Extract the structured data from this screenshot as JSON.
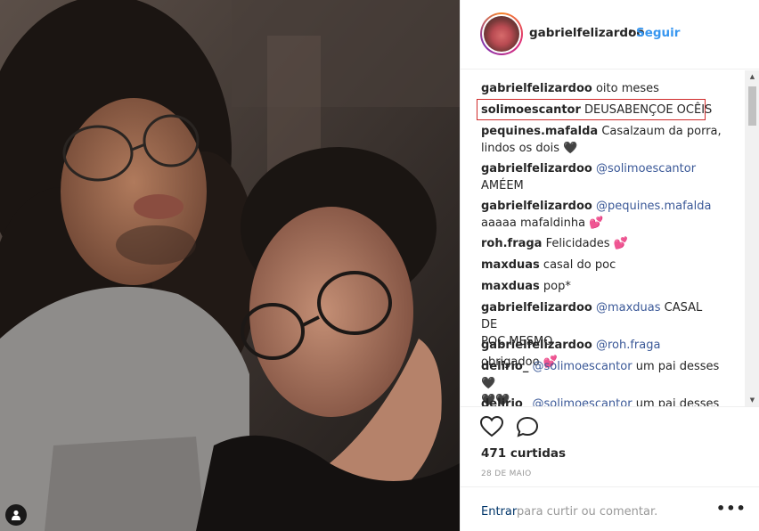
{
  "post": {
    "username": "gabrielfelizardoo",
    "separator": "•",
    "follow_label": "Seguir"
  },
  "comments": [
    {
      "user": "gabrielfelizardoo",
      "mention": "",
      "text": "oito meses",
      "text2": ""
    },
    {
      "user": "solimoescantor",
      "mention": "",
      "text": "DEUSABENÇOE OCÊIS",
      "text2": "",
      "highlighted": true
    },
    {
      "user": "pequines.mafalda",
      "mention": "",
      "text": "Casalzaum da porra,",
      "text2": "lindos os dois 🖤"
    },
    {
      "user": "gabrielfelizardoo",
      "mention": "@solimoescantor",
      "text": "",
      "text2": "AMÉEM"
    },
    {
      "user": "gabrielfelizardoo",
      "mention": "@pequines.mafalda",
      "text": "",
      "text2": "aaaaa mafaldinha 💕"
    },
    {
      "user": "roh.fraga",
      "mention": "",
      "text": "Felicidades 💕",
      "text2": ""
    },
    {
      "user": "maxduas",
      "mention": "",
      "text": "casal do poc",
      "text2": ""
    },
    {
      "user": "maxduas",
      "mention": "",
      "text": "pop*",
      "text2": ""
    },
    {
      "user": "gabrielfelizardoo",
      "mention": "@maxduas",
      "text": "CASAL DE",
      "text2": "POC MESMO"
    },
    {
      "user": "gabrielfelizardoo",
      "mention": "@roh.fraga",
      "text": "obrigadoo 💕",
      "text2": ""
    },
    {
      "user": "delirio_",
      "mention": "@solimoescantor",
      "text": "um pai desses 🖤",
      "text2": "🖤🖤"
    },
    {
      "user": "delirio_",
      "mention": "@solimoescantor",
      "text": "um pai desses 🖤",
      "text2": ""
    }
  ],
  "actions": {
    "heart_icon": "heart-outline-icon",
    "comment_icon": "speech-bubble-icon",
    "likes": "471 curtidas",
    "date": "28 DE MAIO"
  },
  "footer": {
    "login_label": "Entrar",
    "login_rest": "para curtir ou comentar.",
    "more_label": "•••"
  },
  "photo": {
    "tag_icon": "person-tag-icon"
  }
}
